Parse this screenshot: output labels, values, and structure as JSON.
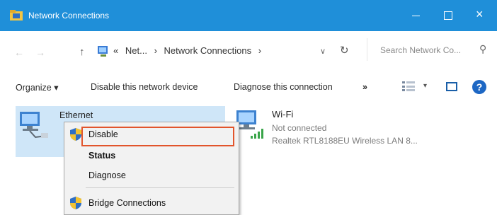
{
  "window": {
    "title": "Network Connections",
    "close_glyph": "×"
  },
  "address": {
    "back_glyph": "←",
    "forward_glyph": "→",
    "up_glyph": "↑",
    "crumbs": [
      "«",
      "Net...",
      "›",
      "Network Connections",
      "›"
    ],
    "dropdown_glyph": "∨",
    "refresh_glyph": "↻",
    "search_placeholder": "Search Network Co...",
    "search_glyph": "⚲"
  },
  "commands": {
    "organize": "Organize ▾",
    "disable_device": "Disable this network device",
    "diagnose": "Diagnose this connection",
    "more": "»",
    "view_dropdown": "▾",
    "help": "?"
  },
  "connections": {
    "ethernet": {
      "name": "Ethernet"
    },
    "wifi": {
      "name": "Wi-Fi",
      "status": "Not connected",
      "adapter": "Realtek RTL8188EU Wireless LAN 8..."
    }
  },
  "context_menu": {
    "items": [
      {
        "label": "Disable"
      },
      {
        "label": "Status"
      },
      {
        "label": "Diagnose"
      },
      {
        "label": "Bridge Connections"
      }
    ]
  },
  "colors": {
    "titlebar": "#1f8fd9",
    "highlight": "#e2552c",
    "selection": "#cfe6f8"
  }
}
